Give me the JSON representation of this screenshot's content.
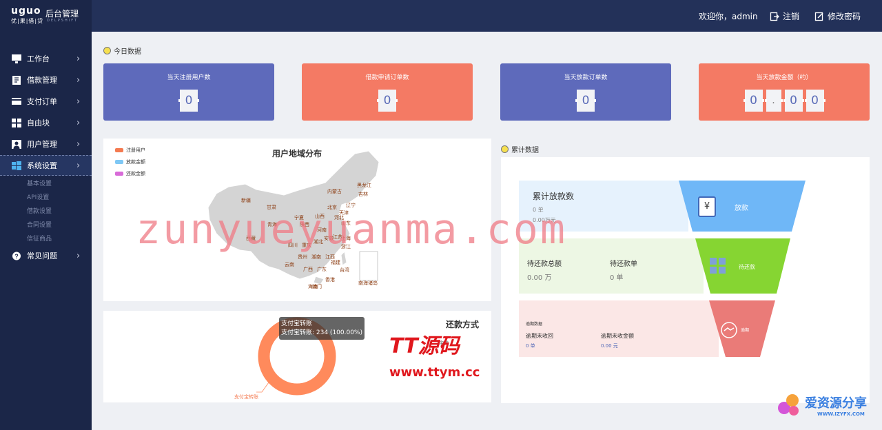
{
  "brand": {
    "logo": "uguo",
    "logo_sub": "优|果|借|贷",
    "title": "后台管理",
    "subtitle": "DELPSHIFT"
  },
  "header": {
    "welcome": "欢迎你，admin",
    "logout": "注销",
    "change_password": "修改密码"
  },
  "sidebar": {
    "items": [
      {
        "label": "工作台",
        "icon": "monitor-icon"
      },
      {
        "label": "借款管理",
        "icon": "document-icon"
      },
      {
        "label": "支付订单",
        "icon": "card-icon"
      },
      {
        "label": "自由块",
        "icon": "grid-icon"
      },
      {
        "label": "用户管理",
        "icon": "user-icon"
      },
      {
        "label": "系统设置",
        "icon": "windows-icon"
      },
      {
        "label": "常见问题",
        "icon": "question-icon"
      }
    ],
    "subitems": [
      "基本设置",
      "API设置",
      "借款设置",
      "合同设置",
      "信征商品"
    ]
  },
  "today": {
    "section_title": "今日数据",
    "cards": [
      {
        "title": "当天注册用户数",
        "digits": [
          "0"
        ],
        "color": "#5e6abb"
      },
      {
        "title": "借款申请订单数",
        "digits": [
          "0"
        ],
        "color": "#f47a64"
      },
      {
        "title": "当天放款订单数",
        "digits": [
          "0"
        ],
        "color": "#5e6abb"
      },
      {
        "title": "当天放款金额（约）",
        "digits": [
          "0",
          ".",
          "0",
          "0"
        ],
        "color": "#f47a64"
      }
    ]
  },
  "map": {
    "title": "用户地域分布",
    "legend": [
      {
        "label": "注册用户",
        "color": "#f47a50"
      },
      {
        "label": "放款金额",
        "color": "#7fc8f5"
      },
      {
        "label": "还款金额",
        "color": "#d86bd8"
      }
    ],
    "provinces": [
      "黑龙江",
      "吉林",
      "内蒙古",
      "辽宁",
      "北京",
      "天津",
      "河北",
      "山东",
      "新疆",
      "甘肃",
      "宁夏",
      "山西",
      "青海",
      "陕西",
      "河南",
      "江苏",
      "安徽",
      "上海",
      "湖北",
      "西藏",
      "四川",
      "重庆",
      "浙江",
      "贵州",
      "湖南",
      "江西",
      "云南",
      "广西",
      "广东",
      "福建",
      "台湾",
      "香港",
      "澳门",
      "海南"
    ],
    "south_sea": "南海诸岛"
  },
  "repay": {
    "title": "还款方式",
    "tooltip_title": "支付宝转账",
    "tooltip_value": "支付宝转账: 234 (100.00%)",
    "slice_label": "支付宝转账",
    "legend_partial": "宝转",
    "chart_data": {
      "type": "pie",
      "categories": [
        "支付宝转账"
      ],
      "values": [
        234
      ],
      "title": "还款方式"
    }
  },
  "watermark": {
    "main": "zunyueyuanma.com",
    "tt_logo": "TT源码",
    "tt_url": "www.ttym.cc",
    "izy_logo": "爱资源分享",
    "izy_url": "WWW.IZYFX.COM"
  },
  "cumulative": {
    "section_title": "累计数据",
    "loan": {
      "title": "累计放款数",
      "count": "0 单",
      "amount": "0.00万元",
      "label": "放款",
      "icon_glyph": "¥"
    },
    "repay": {
      "total_label": "待还款总额",
      "total_value": "0.00 万",
      "orders_label": "待还款单",
      "orders_value": "0 单",
      "label": "待还款"
    },
    "overdue": {
      "title": "逾期数据",
      "uncollected_label": "逾期未收回",
      "uncollected_value": "0 单",
      "amount_label": "逾期未收金额",
      "amount_value": "0.00 元",
      "label": "逾期"
    },
    "colors": {
      "loan": "#6fb7f7",
      "repay": "#86d532",
      "overdue": "#ea7b78"
    }
  }
}
